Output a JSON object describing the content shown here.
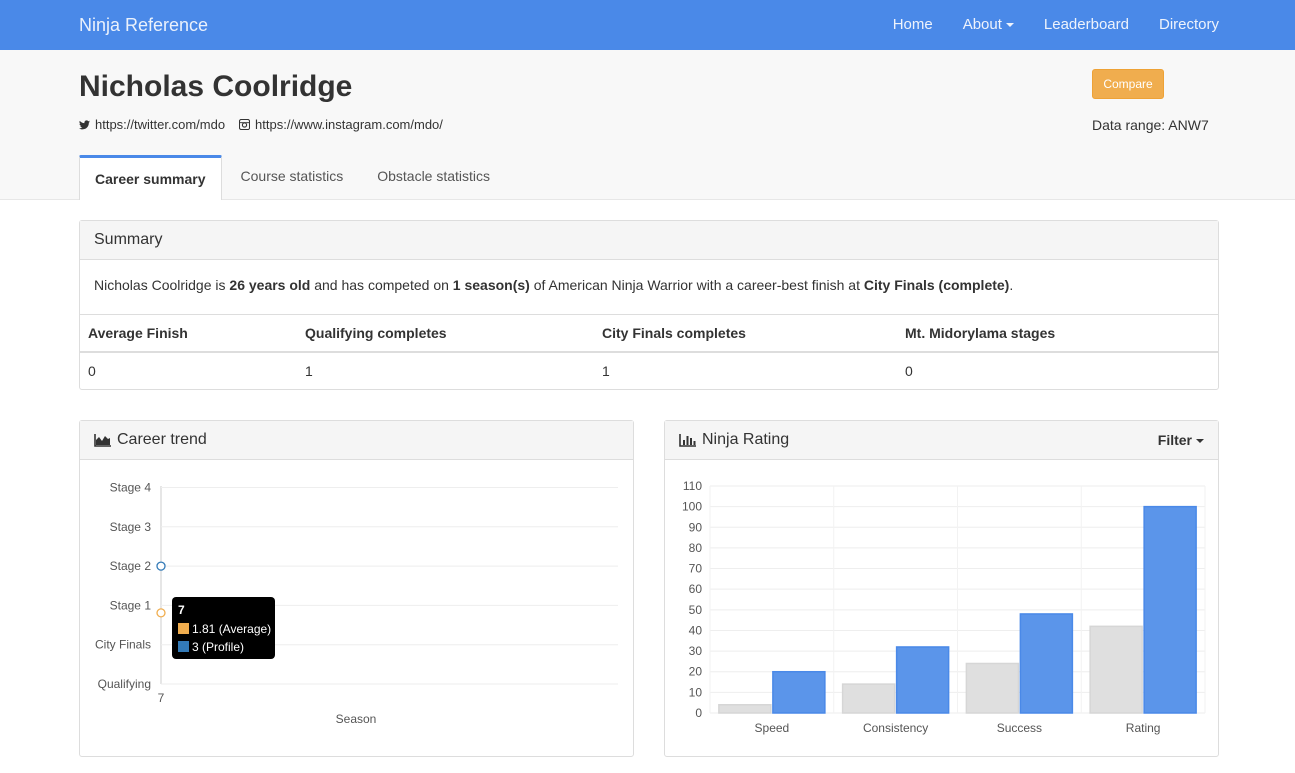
{
  "nav": {
    "brand": "Ninja Reference",
    "links": [
      {
        "label": "Home"
      },
      {
        "label": "About",
        "dropdown": true
      },
      {
        "label": "Leaderboard"
      },
      {
        "label": "Directory"
      }
    ]
  },
  "profile": {
    "name": "Nicholas Coolridge",
    "twitter": "https://twitter.com/mdo",
    "instagram": "https://www.instagram.com/mdo/",
    "compare_label": "Compare",
    "data_range": "Data range: ANW7"
  },
  "tabs": [
    "Career summary",
    "Course statistics",
    "Obstacle statistics"
  ],
  "summary": {
    "title": "Summary",
    "name": "Nicholas Coolridge",
    "t1": " is ",
    "age": "26 years old",
    "t2": " and has competed on ",
    "seasons": "1 season(s)",
    "t3": " of American Ninja Warrior with a career-best finish at ",
    "best": "City Finals (complete)",
    "t4": ".",
    "columns": [
      "Average Finish",
      "Qualifying completes",
      "City Finals completes",
      "Mt. Midorylama stages"
    ],
    "values": [
      "0",
      "1",
      "1",
      "0"
    ]
  },
  "trend": {
    "title": "Career trend",
    "tooltip": {
      "title": "7",
      "rows": [
        "1.81 (Average)",
        "3 (Profile)"
      ]
    }
  },
  "rating": {
    "title": "Ninja Rating",
    "filter": "Filter"
  },
  "colors": {
    "nav": "#4a89e8",
    "average": "#f0ad4e",
    "profile": "#4a89e8",
    "gray_bar": "#dfdfdf",
    "blue_bar": "#5b95ea"
  },
  "chart_data": [
    {
      "type": "scatter",
      "xlabel": "Season",
      "ylabel": "",
      "x_ticks": [
        "7"
      ],
      "y_ticks": [
        "Qualifying",
        "City Finals",
        "Stage 1",
        "Stage 2",
        "Stage 3",
        "Stage 4"
      ],
      "series": [
        {
          "name": "Average",
          "points": [
            {
              "x": "7",
              "y": 1.81
            }
          ]
        },
        {
          "name": "Profile",
          "points": [
            {
              "x": "7",
              "y": 3
            }
          ]
        }
      ]
    },
    {
      "type": "bar",
      "categories": [
        "Speed",
        "Consistency",
        "Success",
        "Rating"
      ],
      "ylim": [
        0,
        110
      ],
      "y_ticks": [
        0,
        10,
        20,
        30,
        40,
        50,
        60,
        70,
        80,
        90,
        100,
        110
      ],
      "series": [
        {
          "values": [
            4,
            14,
            24,
            42
          ]
        },
        {
          "values": [
            20,
            32,
            48,
            100
          ]
        }
      ]
    }
  ]
}
